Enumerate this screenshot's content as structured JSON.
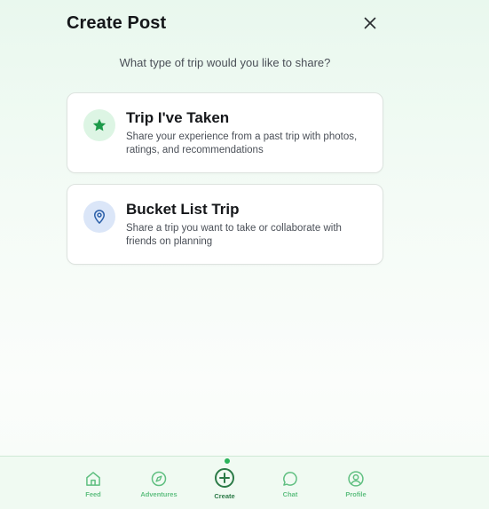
{
  "header": {
    "title": "Create Post",
    "close_icon": "close-icon"
  },
  "prompt": "What type of trip would you like to share?",
  "cards": [
    {
      "title": "Trip I've Taken",
      "description": "Share your experience from a past trip with photos, ratings, and recommendations",
      "icon": "star-icon",
      "icon_color": "#1c9a49",
      "icon_bg": "#ddf5e4"
    },
    {
      "title": "Bucket List Trip",
      "description": "Share a trip you want to take or collaborate with friends on planning",
      "icon": "map-pin-icon",
      "icon_color": "#2b5fa8",
      "icon_bg": "#dbe6f8"
    }
  ],
  "nav": {
    "items": [
      {
        "label": "Feed",
        "icon": "home-icon"
      },
      {
        "label": "Adventures",
        "icon": "compass-icon"
      },
      {
        "label": "Create",
        "icon": "plus-circle-icon",
        "active": true
      },
      {
        "label": "Chat",
        "icon": "chat-bubble-icon"
      },
      {
        "label": "Profile",
        "icon": "user-circle-icon"
      }
    ]
  },
  "colors": {
    "accent": "#1c9a49",
    "nav_label": "#5fbf80",
    "nav_active": "#2b7a47"
  }
}
